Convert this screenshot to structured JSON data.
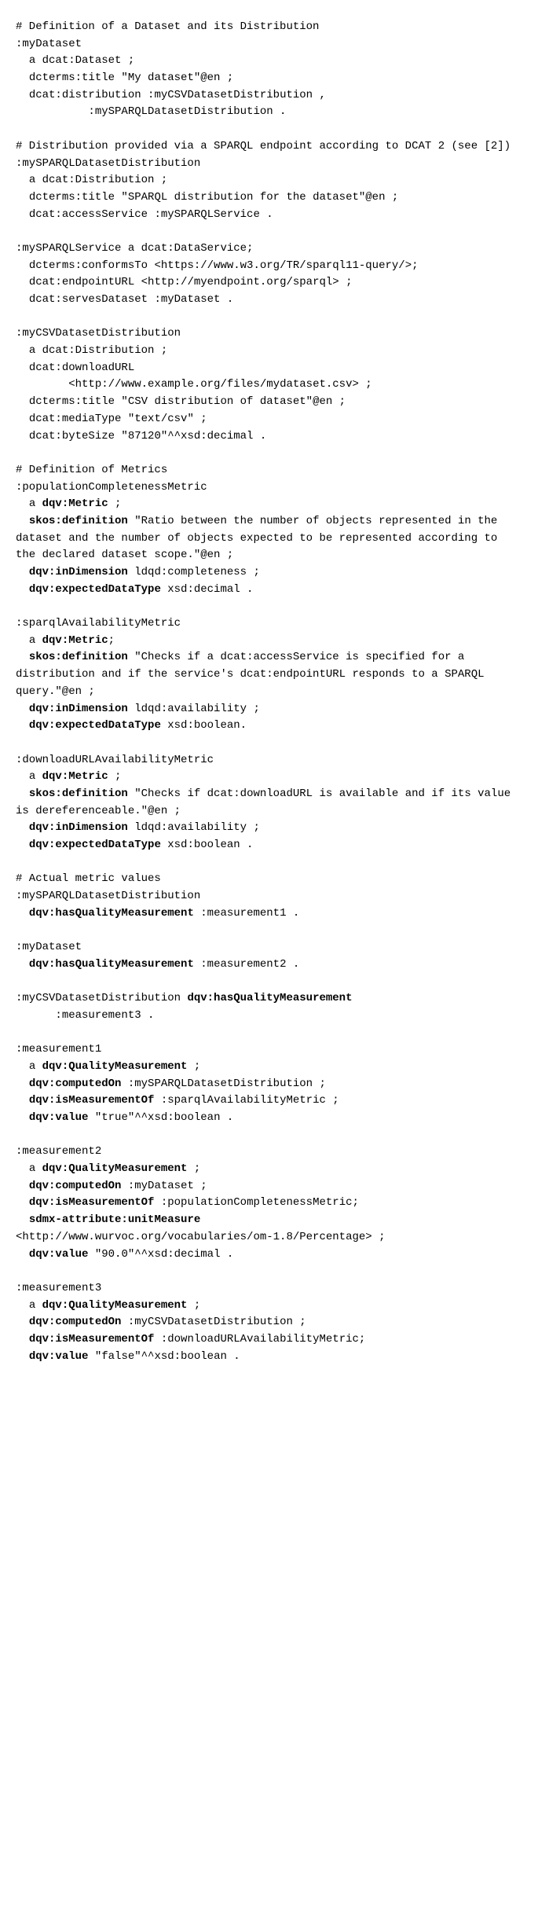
{
  "code": {
    "l01": "# Definition of a Dataset and its Distribution",
    "l02": ":myDataset",
    "l03": "  a dcat:Dataset ;",
    "l04": "  dcterms:title \"My dataset\"@en ;",
    "l05": "  dcat:distribution :myCSVDatasetDistribution ,",
    "l06": "           :mySPARQLDatasetDistribution .",
    "l07": "",
    "l08": "# Distribution provided via a SPARQL endpoint according to DCAT 2 (see [2])",
    "l09": ":mySPARQLDatasetDistribution",
    "l10": "  a dcat:Distribution ;",
    "l11": "  dcterms:title \"SPARQL distribution for the dataset\"@en ;",
    "l12": "  dcat:accessService :mySPARQLService .",
    "l13": "",
    "l14": ":mySPARQLService a dcat:DataService;",
    "l15": "  dcterms:conformsTo <https://www.w3.org/TR/sparql11-query/>;",
    "l16": "  dcat:endpointURL <http://myendpoint.org/sparql> ;",
    "l17": "  dcat:servesDataset :myDataset .",
    "l18": "",
    "l19": ":myCSVDatasetDistribution",
    "l20": "  a dcat:Distribution ;",
    "l21": "  dcat:downloadURL",
    "l22": "        <http://www.example.org/files/mydataset.csv> ;",
    "l23": "  dcterms:title \"CSV distribution of dataset\"@en ;",
    "l24": "  dcat:mediaType \"text/csv\" ;",
    "l25": "  dcat:byteSize \"87120\"^^xsd:decimal .",
    "l26": "",
    "l27": "# Definition of Metrics",
    "l28": ":populationCompletenessMetric",
    "l29a": "  a ",
    "l29b": "dqv:Metric",
    "l29c": " ;",
    "l30a": "  ",
    "l30b": "skos:definition",
    "l30c": " \"Ratio between the number of objects represented in the dataset and the number of objects expected to be represented according to the declared dataset scope.\"@en ;",
    "l31a": "  ",
    "l31b": "dqv:inDimension",
    "l31c": " ldqd:completeness ;",
    "l32a": "  ",
    "l32b": "dqv:expectedDataType",
    "l32c": " xsd:decimal .",
    "l33": "",
    "l34": ":sparqlAvailabilityMetric",
    "l35a": "  a ",
    "l35b": "dqv:Metric",
    "l35c": ";",
    "l36a": "  ",
    "l36b": "skos:definition",
    "l36c": " \"Checks if a dcat:accessService is specified for a distribution and if the service's dcat:endpointURL responds to a SPARQL query.\"@en ;",
    "l37a": "  ",
    "l37b": "dqv:inDimension",
    "l37c": " ldqd:availability ;",
    "l38a": "  ",
    "l38b": "dqv:expectedDataType",
    "l38c": " xsd:boolean.",
    "l39": "",
    "l40": ":downloadURLAvailabilityMetric",
    "l41a": "  a ",
    "l41b": "dqv:Metric",
    "l41c": " ;",
    "l42a": "  ",
    "l42b": "skos:definition",
    "l42c": " \"Checks if dcat:downloadURL is available and if its value is dereferenceable.\"@en ;",
    "l43a": "  ",
    "l43b": "dqv:inDimension",
    "l43c": " ldqd:availability ;",
    "l44a": "  ",
    "l44b": "dqv:expectedDataType",
    "l44c": " xsd:boolean .",
    "l45": "",
    "l46": "# Actual metric values",
    "l47": ":mySPARQLDatasetDistribution",
    "l48a": "  ",
    "l48b": "dqv:hasQualityMeasurement",
    "l48c": " :measurement1 .",
    "l49": "",
    "l50": ":myDataset",
    "l51a": "  ",
    "l51b": "dqv:hasQualityMeasurement",
    "l51c": " :measurement2 .",
    "l52": "",
    "l53a": ":myCSVDatasetDistribution ",
    "l53b": "dqv:hasQualityMeasurement",
    "l53c": "\n      :measurement3 .",
    "l54": "",
    "l55": ":measurement1",
    "l56a": "  a ",
    "l56b": "dqv:QualityMeasurement",
    "l56c": " ;",
    "l57a": "  ",
    "l57b": "dqv:computedOn",
    "l57c": " :mySPARQLDatasetDistribution ;",
    "l58a": "  ",
    "l58b": "dqv:isMeasurementOf",
    "l58c": " :sparqlAvailabilityMetric ;",
    "l59a": "  ",
    "l59b": "dqv:value",
    "l59c": " \"true\"^^xsd:boolean .",
    "l60": "",
    "l61": ":measurement2",
    "l62a": "  a ",
    "l62b": "dqv:QualityMeasurement",
    "l62c": " ;",
    "l63a": "  ",
    "l63b": "dqv:computedOn",
    "l63c": " :myDataset ;",
    "l64a": "  ",
    "l64b": "dqv:isMeasurementOf",
    "l64c": " :populationCompletenessMetric;",
    "l65a": "  ",
    "l65b": "sdmx-attribute:unitMeasure",
    "l65c": "\n<http://www.wurvoc.org/vocabularies/om-1.8/Percentage> ;",
    "l66a": "  ",
    "l66b": "dqv:value",
    "l66c": " \"90.0\"^^xsd:decimal .",
    "l67": "",
    "l68": ":measurement3",
    "l69a": "  a ",
    "l69b": "dqv:QualityMeasurement",
    "l69c": " ;",
    "l70a": "  ",
    "l70b": "dqv:computedOn",
    "l70c": " :myCSVDatasetDistribution ;",
    "l71a": "  ",
    "l71b": "dqv:isMeasurementOf",
    "l71c": " :downloadURLAvailabilityMetric;",
    "l72a": "  ",
    "l72b": "dqv:value",
    "l72c": " \"false\"^^xsd:boolean ."
  }
}
